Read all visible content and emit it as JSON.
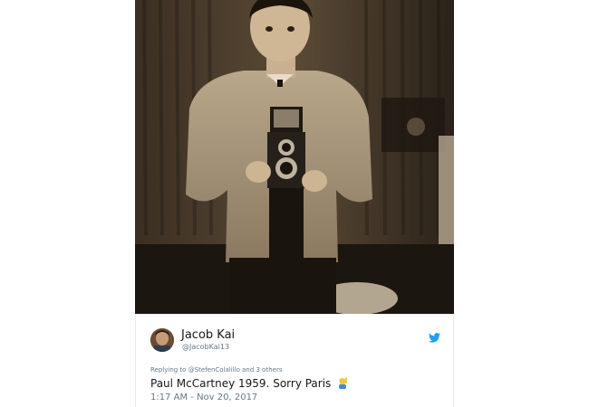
{
  "tweet": {
    "display_name": "Jacob Kai",
    "handle": "@JacobKai13",
    "reply_prefix": "Replying to",
    "reply_to": "@StefenColalillo",
    "reply_suffix": "and 3 others",
    "text": "Paul McCartney 1959. Sorry Paris",
    "emoji": "woman-raising-hand-emoji",
    "timestamp": "1:17 AM - Nov 20, 2017"
  },
  "icons": {
    "platform": "twitter-bird-icon"
  },
  "colors": {
    "twitter_blue": "#1da1f2",
    "secondary_text": "#657786",
    "primary_text": "#14171a"
  }
}
